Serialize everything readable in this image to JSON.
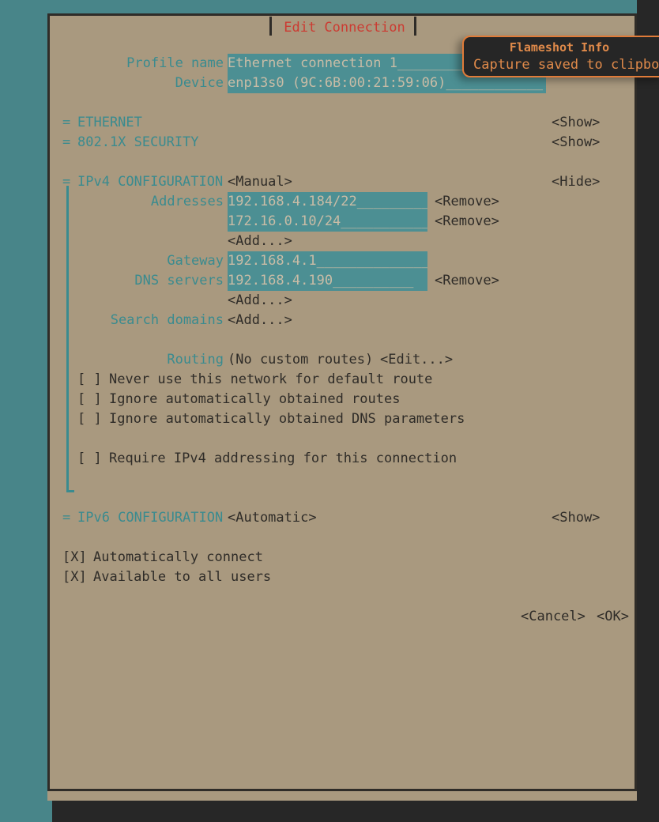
{
  "desktop": {
    "background_color": "#488589",
    "taskbar_color": "#272727"
  },
  "terminal": {
    "background_color": "#a9997f"
  },
  "dialog": {
    "title": "Edit Connection",
    "title_color": "#cc3b32",
    "border_color": "#2f2c28",
    "accent_color": "#3a8b8f",
    "field_background": "#4c8f93",
    "field_text_color": "#c9bca6"
  },
  "form": {
    "profile_name": {
      "label": "Profile name",
      "value": "Ethernet connection 1",
      "filler": "_________"
    },
    "device": {
      "label": "Device",
      "value": "enp13s0 (9C:6B:00:21:59:06)",
      "filler": "____________"
    }
  },
  "sections": {
    "ethernet": {
      "marker": "=",
      "label": "ETHERNET",
      "toggle": "<Show>"
    },
    "security8021x": {
      "marker": "=",
      "label": "802.1X SECURITY",
      "toggle": "<Show>"
    },
    "ipv4": {
      "marker": "=",
      "label": "IPv4 CONFIGURATION",
      "mode": "<Manual>",
      "toggle": "<Hide>",
      "addresses": {
        "label": "Addresses",
        "entries": [
          {
            "value": "192.168.4.184/22",
            "filler": "_________",
            "action": "<Remove>"
          },
          {
            "value": "172.16.0.10/24",
            "filler": "___________",
            "action": "<Remove>"
          }
        ],
        "add": "<Add...>"
      },
      "gateway": {
        "label": "Gateway",
        "value": "192.168.4.1",
        "filler": "______________"
      },
      "dns_servers": {
        "label": "DNS servers",
        "entries": [
          {
            "value": "192.168.4.190",
            "filler": "__________",
            "action": "<Remove>"
          }
        ],
        "add": "<Add...>"
      },
      "search_domains": {
        "label": "Search domains",
        "add": "<Add...>"
      },
      "routing": {
        "label": "Routing",
        "value": "(No custom routes)",
        "action": "<Edit...>"
      },
      "checkboxes": [
        {
          "state": "[ ]",
          "label": "Never use this network for default route"
        },
        {
          "state": "[ ]",
          "label": "Ignore automatically obtained routes"
        },
        {
          "state": "[ ]",
          "label": "Ignore automatically obtained DNS parameters"
        },
        {
          "state": "[ ]",
          "label": "Require IPv4 addressing for this connection"
        }
      ]
    },
    "ipv6": {
      "marker": "=",
      "label": "IPv6 CONFIGURATION",
      "mode": "<Automatic>",
      "toggle": "<Show>"
    }
  },
  "global_checkboxes": [
    {
      "state": "[X]",
      "label": "Automatically connect"
    },
    {
      "state": "[X]",
      "label": "Available to all users"
    }
  ],
  "buttons": {
    "cancel": "<Cancel>",
    "ok": "<OK>"
  },
  "notification": {
    "title": "Flameshot Info",
    "body": "Capture saved to clipboa",
    "border_color": "#e07b39",
    "text_color": "#e08a4a",
    "background_color": "#262626"
  }
}
